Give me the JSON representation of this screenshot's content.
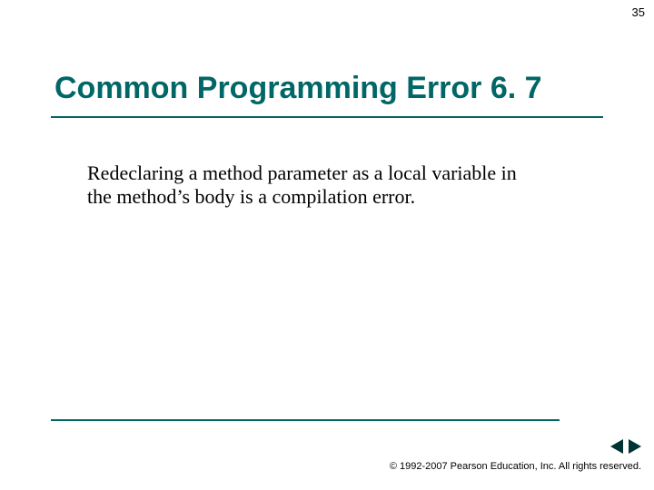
{
  "page_number": "35",
  "title": "Common Programming Error 6. 7",
  "body": "Redeclaring a method parameter as a local variable in the method’s body is a compilation error.",
  "copyright": "© 1992-2007 Pearson Education, Inc.  All rights reserved."
}
